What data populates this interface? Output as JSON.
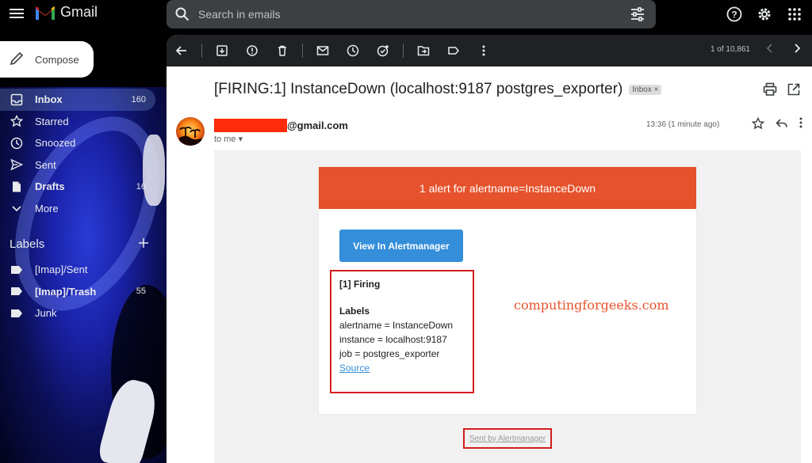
{
  "app": {
    "name": "Gmail"
  },
  "search": {
    "placeholder": "Search in emails"
  },
  "compose": {
    "label": "Compose"
  },
  "nav": [
    {
      "label": "Inbox",
      "count": "160",
      "icon": "inbox-icon"
    },
    {
      "label": "Starred",
      "count": "",
      "icon": "star-icon"
    },
    {
      "label": "Snoozed",
      "count": "",
      "icon": "clock-icon"
    },
    {
      "label": "Sent",
      "count": "",
      "icon": "send-icon"
    },
    {
      "label": "Drafts",
      "count": "16",
      "icon": "draft-icon"
    },
    {
      "label": "More",
      "count": "",
      "icon": "chevron-down-icon"
    }
  ],
  "labels": {
    "heading": "Labels",
    "items": [
      {
        "label": "[Imap]/Sent",
        "count": ""
      },
      {
        "label": "[Imap]/Trash",
        "count": "55"
      },
      {
        "label": "Junk",
        "count": ""
      }
    ]
  },
  "toolbar": {
    "pager": "1 of 10,861"
  },
  "email": {
    "subject": "[FIRING:1] InstanceDown (localhost:9187 postgres_exporter)",
    "chip": "Inbox",
    "sender_suffix": "@gmail.com",
    "to": "to me",
    "time": "13:36 (1 minute ago)",
    "header_text": "1 alert for alertname=InstanceDown",
    "button": "View In Alertmanager",
    "firing": "[1] Firing",
    "labels_heading": "Labels",
    "lines": [
      "alertname = InstanceDown",
      "instance = localhost:9187",
      "job = postgres_exporter"
    ],
    "source": "Source",
    "watermark": "computingforgeeks.com",
    "sent_by": "Sent by Alertmanager"
  },
  "colors": {
    "alert_header": "#e6522c",
    "button": "#348eda",
    "highlight": "#d21d1d",
    "redaction": "#ff2b0a"
  }
}
